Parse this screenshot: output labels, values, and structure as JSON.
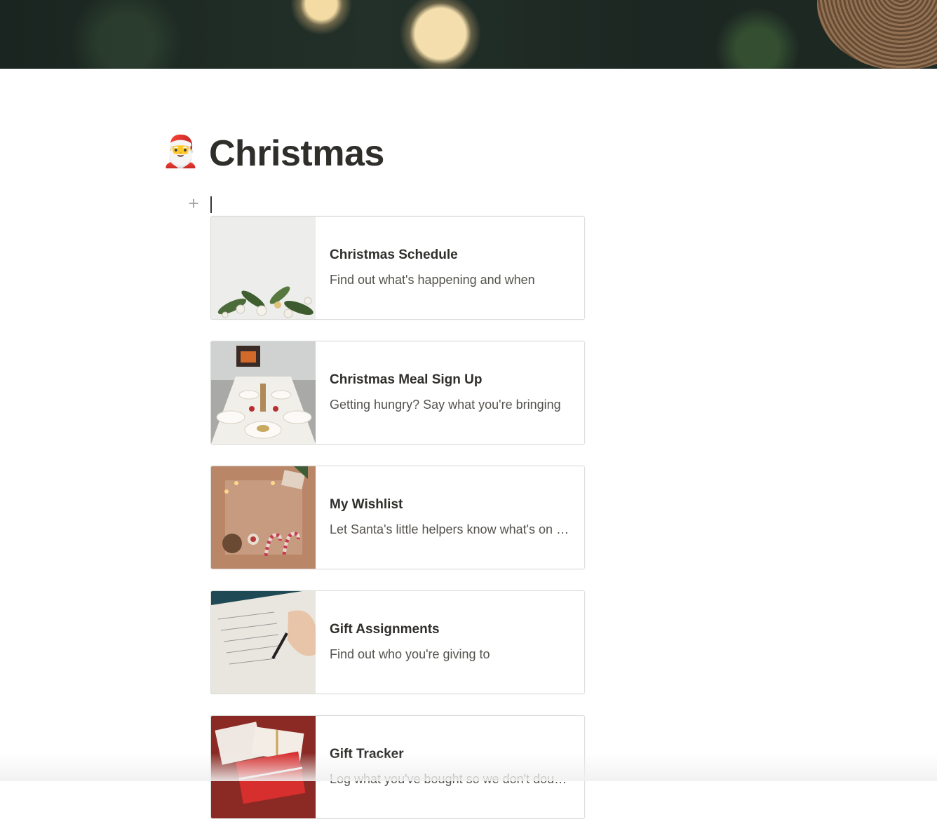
{
  "page": {
    "icon": "🎅",
    "title": "Christmas",
    "add_block_icon": "+"
  },
  "cards": [
    {
      "title": "Christmas Schedule",
      "description": "Find out what's happening and when",
      "thumb": "ornaments-on-white"
    },
    {
      "title": "Christmas Meal Sign Up",
      "description": "Getting hungry? Say what you're bringing",
      "thumb": "dinner-table"
    },
    {
      "title": "My Wishlist",
      "description": "Let Santa's little helpers know what's on your list",
      "thumb": "candy-canes"
    },
    {
      "title": "Gift Assignments",
      "description": "Find out who you're giving to",
      "thumb": "writing-list"
    },
    {
      "title": "Gift Tracker",
      "description": "Log what you've bought so we don't double up",
      "thumb": "wrapped-gifts"
    }
  ]
}
